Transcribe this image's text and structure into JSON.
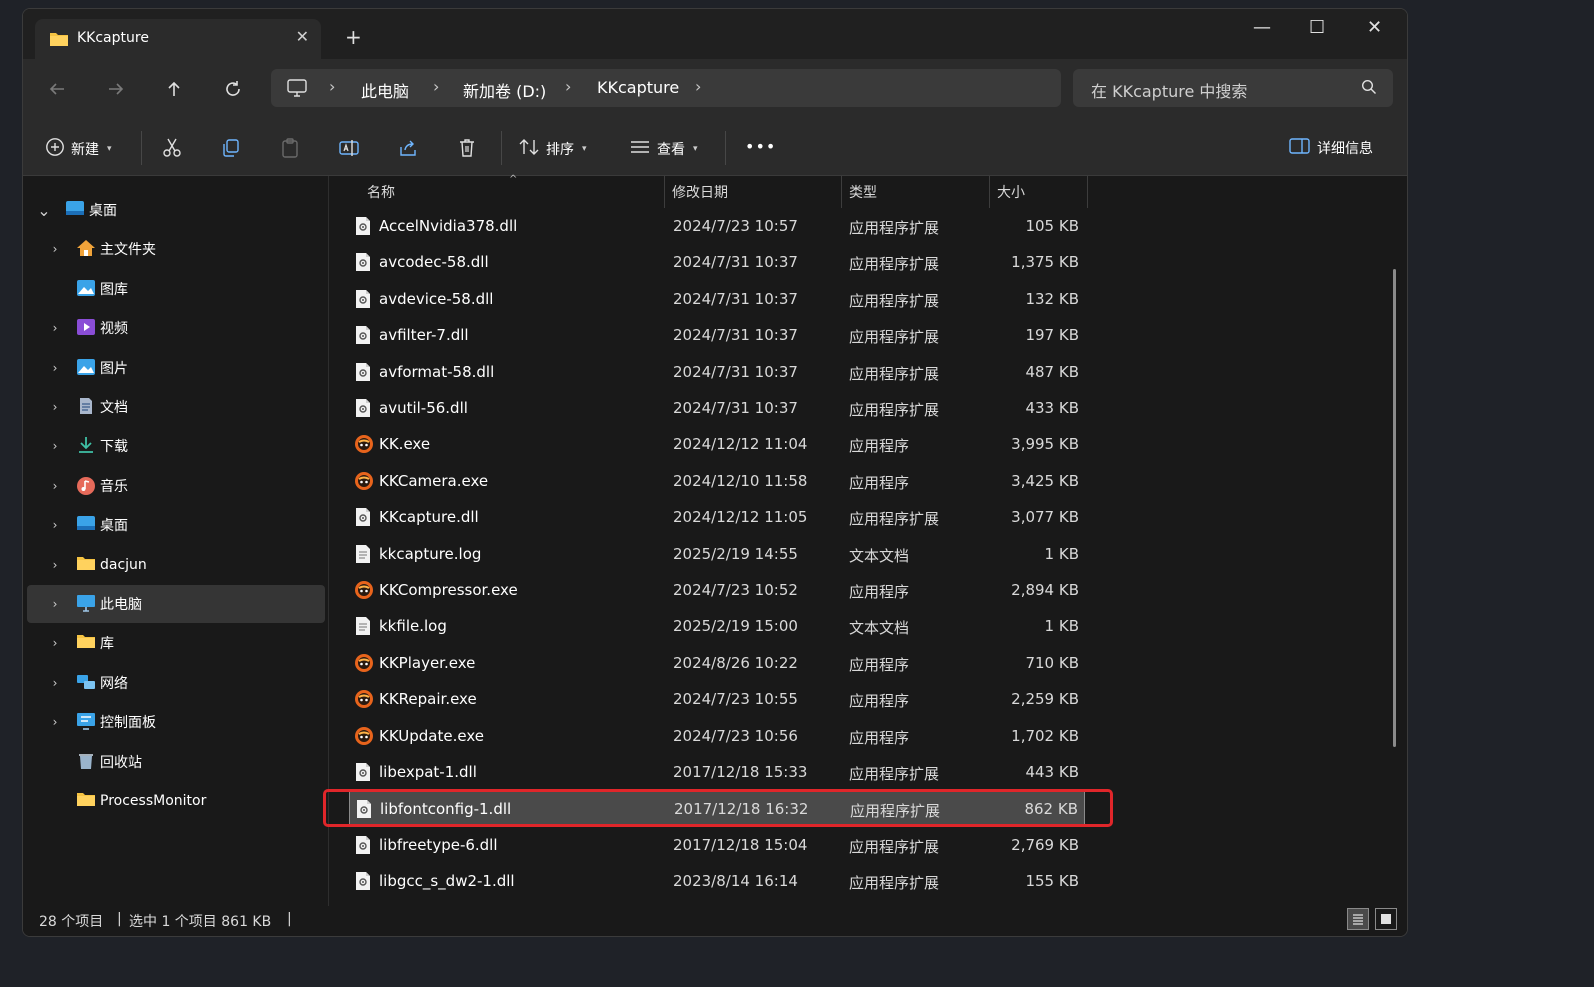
{
  "window": {
    "tab_title": "KKcapture",
    "new_tab": "+",
    "minimize": "—",
    "maximize": "☐",
    "close": "✕",
    "tab_close": "✕"
  },
  "address": {
    "crumbs": [
      "此电脑",
      "新加卷 (D:)",
      "KKcapture"
    ],
    "separator": "›",
    "search_placeholder": "在 KKcapture 中搜索"
  },
  "toolbar": {
    "new_label": "新建",
    "sort_label": "排序",
    "view_label": "查看",
    "more_label": "•••",
    "details_label": "详细信息"
  },
  "sidebar": {
    "items": [
      {
        "label": "桌面",
        "icon": "desktop-icon",
        "chevron": "expanded"
      },
      {
        "label": "主文件夹",
        "icon": "home-icon",
        "chevron": "collapsed"
      },
      {
        "label": "图库",
        "icon": "gallery-icon",
        "chevron": "none"
      },
      {
        "label": "视频",
        "icon": "video-icon",
        "chevron": "collapsed"
      },
      {
        "label": "图片",
        "icon": "pictures-icon",
        "chevron": "collapsed"
      },
      {
        "label": "文档",
        "icon": "documents-icon",
        "chevron": "collapsed"
      },
      {
        "label": "下载",
        "icon": "download-icon",
        "chevron": "collapsed"
      },
      {
        "label": "音乐",
        "icon": "music-icon",
        "chevron": "collapsed"
      },
      {
        "label": "桌面",
        "icon": "desktop-icon",
        "chevron": "collapsed"
      },
      {
        "label": "dacjun",
        "icon": "folder-icon",
        "chevron": "collapsed"
      },
      {
        "label": "此电脑",
        "icon": "computer-icon",
        "chevron": "collapsed",
        "selected": true
      },
      {
        "label": "库",
        "icon": "folder-icon",
        "chevron": "collapsed"
      },
      {
        "label": "网络",
        "icon": "network-icon",
        "chevron": "collapsed"
      },
      {
        "label": "控制面板",
        "icon": "control-panel-icon",
        "chevron": "collapsed"
      },
      {
        "label": "回收站",
        "icon": "recycle-bin-icon",
        "chevron": "none"
      },
      {
        "label": "ProcessMonitor",
        "icon": "folder-icon",
        "chevron": "none"
      }
    ]
  },
  "columns": {
    "name": "名称",
    "date": "修改日期",
    "type": "类型",
    "size": "大小"
  },
  "files": [
    {
      "name": "AccelNvidia378.dll",
      "date": "2024/7/23 10:57",
      "type": "应用程序扩展",
      "size": "105 KB",
      "icon": "dll-icon"
    },
    {
      "name": "avcodec-58.dll",
      "date": "2024/7/31 10:37",
      "type": "应用程序扩展",
      "size": "1,375 KB",
      "icon": "dll-icon"
    },
    {
      "name": "avdevice-58.dll",
      "date": "2024/7/31 10:37",
      "type": "应用程序扩展",
      "size": "132 KB",
      "icon": "dll-icon"
    },
    {
      "name": "avfilter-7.dll",
      "date": "2024/7/31 10:37",
      "type": "应用程序扩展",
      "size": "197 KB",
      "icon": "dll-icon"
    },
    {
      "name": "avformat-58.dll",
      "date": "2024/7/31 10:37",
      "type": "应用程序扩展",
      "size": "487 KB",
      "icon": "dll-icon"
    },
    {
      "name": "avutil-56.dll",
      "date": "2024/7/31 10:37",
      "type": "应用程序扩展",
      "size": "433 KB",
      "icon": "dll-icon"
    },
    {
      "name": "KK.exe",
      "date": "2024/12/12 11:04",
      "type": "应用程序",
      "size": "3,995 KB",
      "icon": "exe-icon"
    },
    {
      "name": "KKCamera.exe",
      "date": "2024/12/10 11:58",
      "type": "应用程序",
      "size": "3,425 KB",
      "icon": "exe-icon"
    },
    {
      "name": "KKcapture.dll",
      "date": "2024/12/12 11:05",
      "type": "应用程序扩展",
      "size": "3,077 KB",
      "icon": "dll-icon"
    },
    {
      "name": "kkcapture.log",
      "date": "2025/2/19 14:55",
      "type": "文本文档",
      "size": "1 KB",
      "icon": "text-file-icon"
    },
    {
      "name": "KKCompressor.exe",
      "date": "2024/7/23 10:52",
      "type": "应用程序",
      "size": "2,894 KB",
      "icon": "exe-icon"
    },
    {
      "name": "kkfile.log",
      "date": "2025/2/19 15:00",
      "type": "文本文档",
      "size": "1 KB",
      "icon": "text-file-icon"
    },
    {
      "name": "KKPlayer.exe",
      "date": "2024/8/26 10:22",
      "type": "应用程序",
      "size": "710 KB",
      "icon": "exe-icon"
    },
    {
      "name": "KKRepair.exe",
      "date": "2024/7/23 10:55",
      "type": "应用程序",
      "size": "2,259 KB",
      "icon": "exe-icon"
    },
    {
      "name": "KKUpdate.exe",
      "date": "2024/7/23 10:56",
      "type": "应用程序",
      "size": "1,702 KB",
      "icon": "exe-icon"
    },
    {
      "name": "libexpat-1.dll",
      "date": "2017/12/18 15:33",
      "type": "应用程序扩展",
      "size": "443 KB",
      "icon": "dll-icon"
    },
    {
      "name": "libfontconfig-1.dll",
      "date": "2017/12/18 16:32",
      "type": "应用程序扩展",
      "size": "862 KB",
      "icon": "dll-icon",
      "selected": true
    },
    {
      "name": "libfreetype-6.dll",
      "date": "2017/12/18 15:04",
      "type": "应用程序扩展",
      "size": "2,769 KB",
      "icon": "dll-icon"
    },
    {
      "name": "libgcc_s_dw2-1.dll",
      "date": "2023/8/14 16:14",
      "type": "应用程序扩展",
      "size": "155 KB",
      "icon": "dll-icon"
    }
  ],
  "status": {
    "count": "28 个项目",
    "selection": "选中 1 个项目  861 KB",
    "divider": "|"
  },
  "colors": {
    "highlight_border": "#e0262a",
    "folder": "#f5c342",
    "accent": "#4cc2ff"
  }
}
